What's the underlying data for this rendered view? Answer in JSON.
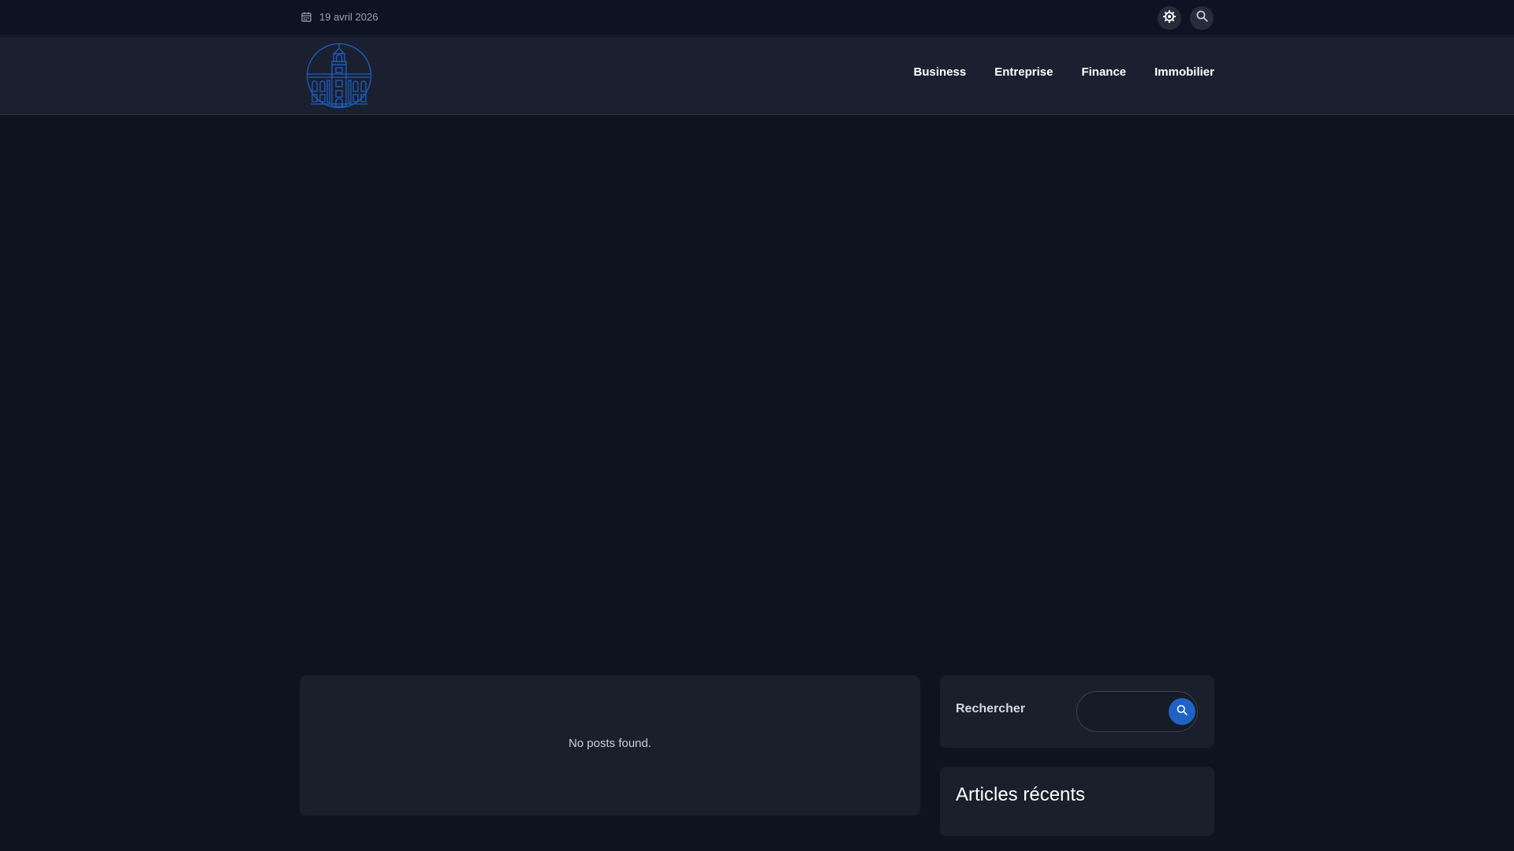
{
  "topbar": {
    "date": "19 avril 2026",
    "icons": [
      "calendar-icon",
      "theme-gear-icon",
      "search-icon"
    ]
  },
  "nav": {
    "items": [
      {
        "label": "Business"
      },
      {
        "label": "Entreprise"
      },
      {
        "label": "Finance"
      },
      {
        "label": "Immobilier"
      }
    ]
  },
  "main": {
    "empty_message": "No posts found."
  },
  "sidebar": {
    "search": {
      "label": "Rechercher",
      "placeholder": ""
    },
    "recent": {
      "title": "Articles récents"
    }
  },
  "colors": {
    "background": "#0e1320",
    "header": "#1a2030",
    "card": "#1a1f2c",
    "accent": "#1e63c4",
    "logo_stroke": "#1f5fbf"
  }
}
